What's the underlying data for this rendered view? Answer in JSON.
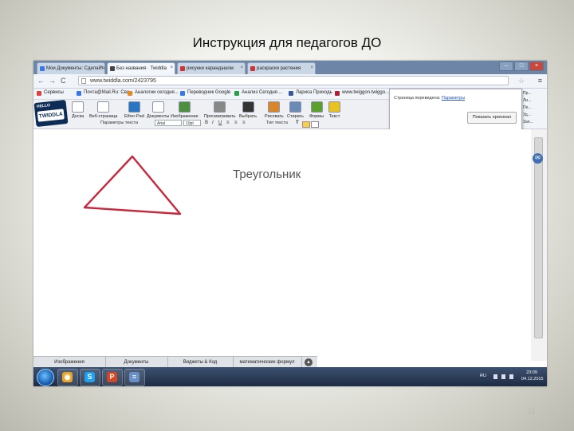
{
  "slide": {
    "title": "Инструкция для педагогов ДО",
    "page_number": "11"
  },
  "browser": {
    "tabs": [
      {
        "label": "Мои Документы: Сделайте",
        "active": false,
        "icon_color": "#3b78e7"
      },
      {
        "label": "Без названия · Twiddla",
        "active": true,
        "icon_color": "#444"
      },
      {
        "label": "рисунки карандашом",
        "active": false,
        "icon_color": "#c33"
      },
      {
        "label": "раскраски растения",
        "active": false,
        "icon_color": "#c33"
      }
    ],
    "window_controls": {
      "minimize": "–",
      "maximize": "□",
      "close": "×"
    },
    "back": "←",
    "forward": "→",
    "reload": "C",
    "url": "www.twiddla.com/2423795",
    "star": "☆",
    "menu": "≡",
    "bookmarks": [
      {
        "label": "Сервисы",
        "icon_color": "#d44"
      },
      {
        "label": "Почта@Mail.Ru: Сва...",
        "icon_color": "#3b78e7"
      },
      {
        "label": "Аналогии сегодня...",
        "icon_color": "#e08a2a"
      },
      {
        "label": "Переводчик Google",
        "icon_color": "#3b78e7"
      },
      {
        "label": "Анализ Сегодня ...",
        "icon_color": "#2a9d4a"
      },
      {
        "label": "Лариса Приходь",
        "icon_color": "#3b5998"
      },
      {
        "label": "www.twiggon.twiggo...",
        "icon_color": "#a23"
      }
    ]
  },
  "twiddla": {
    "logo_hello": "HELLO",
    "logo_brand": "TWIDDLA",
    "tools": [
      {
        "label": "Доска",
        "icon_color": "#ffffff"
      },
      {
        "label": "Веб-страница",
        "icon_color": "#ffffff"
      },
      {
        "label": "Ether-Pad",
        "icon_color": "#2a74c4"
      },
      {
        "label": "Документы",
        "icon_color": "#ffffff"
      },
      {
        "label": "Изображение",
        "icon_color": "#4c8f3e"
      },
      {
        "label": "Просматривать",
        "icon_color": "#888888"
      },
      {
        "label": "Выбрать",
        "icon_color": "#333333"
      },
      {
        "label": "Рисовать",
        "icon_color": "#d9862b"
      },
      {
        "label": "Стирать",
        "icon_color": "#6a8bb5"
      },
      {
        "label": "Формы",
        "icon_color": "#5aa02c"
      },
      {
        "label": "Текст",
        "icon_color": "#e8c21e"
      }
    ],
    "text_params_label": "Параметры текста",
    "font_select": "Arial",
    "size_select": "10pt",
    "shapes_label": "Тип текста",
    "popup": {
      "line": "Страница переведена:",
      "link": "Параметры",
      "button": "Показать оригинал"
    },
    "right_panel": [
      "Пр...",
      "Ли...",
      "Пе...",
      "Уд...",
      "Зап..."
    ],
    "canvas_text": "Треугольник",
    "triangle_color": "#c8283c",
    "bottom_tabs": [
      "Изображения",
      "Документы",
      "Виджеты & Код",
      "математических формул"
    ],
    "bottom_arrow": "▲"
  },
  "taskbar": {
    "apps": [
      {
        "name": "chrome",
        "glyph": "◉",
        "color": "#e8a52b"
      },
      {
        "name": "skype",
        "glyph": "S",
        "color": "#1da1f2"
      },
      {
        "name": "powerpoint",
        "glyph": "P",
        "color": "#d24726"
      },
      {
        "name": "document",
        "glyph": "≡",
        "color": "#6a8fc6"
      }
    ],
    "lang": "RU",
    "time": "23:09",
    "date": "04.12.2015"
  }
}
